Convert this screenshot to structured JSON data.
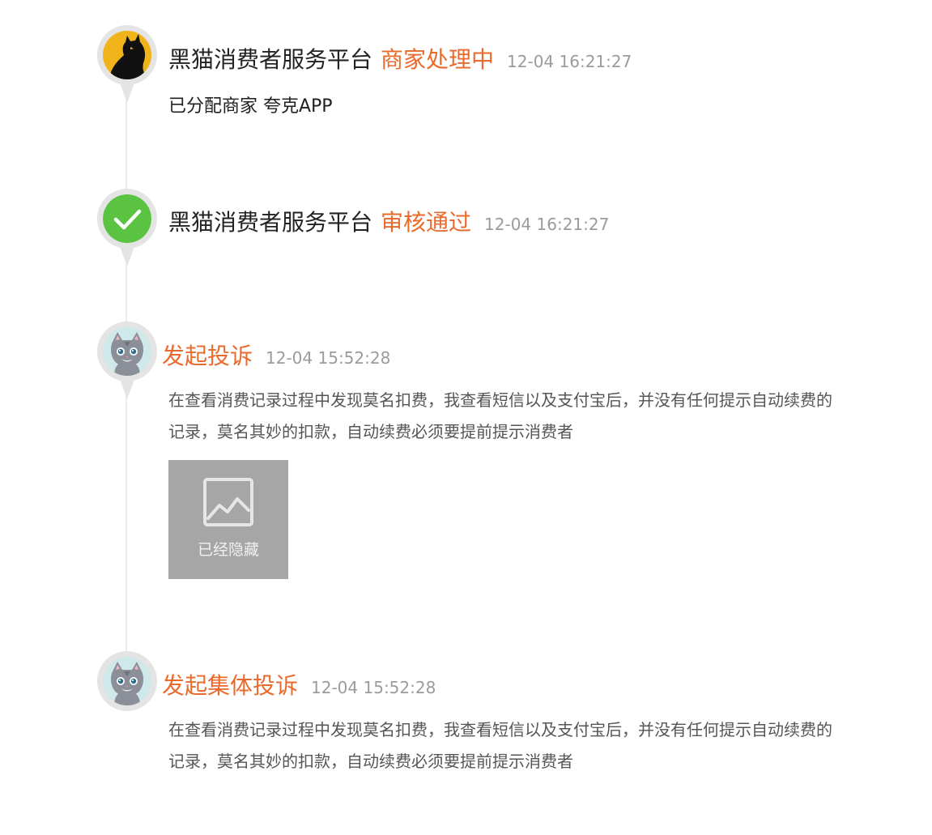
{
  "entries": [
    {
      "avatar": "black-cat-logo",
      "name": "黑猫消费者服务平台",
      "status": "商家处理中",
      "time": "12-04 16:21:27",
      "desc": "已分配商家 夸克APP"
    },
    {
      "avatar": "check-icon",
      "name": "黑猫消费者服务平台",
      "status": "审核通过",
      "time": "12-04 16:21:27"
    },
    {
      "avatar": "gray-cat-avatar",
      "status": "发起投诉",
      "time": "12-04 15:52:28",
      "text": "在查看消费记录过程中发现莫名扣费，我查看短信以及支付宝后，并没有任何提示自动续费的记录，莫名其妙的扣款，自动续费必须要提前提示消费者",
      "image_label": "已经隐藏"
    },
    {
      "avatar": "gray-cat-avatar",
      "status": "发起集体投诉",
      "time": "12-04 15:52:28",
      "text": "在查看消费记录过程中发现莫名扣费，我查看短信以及支付宝后，并没有任何提示自动续费的记录，莫名其妙的扣款，自动续费必须要提前提示消费者"
    }
  ],
  "colors": {
    "status": "#ea6a2c",
    "check_green": "#5ac341",
    "logo_yellow": "#f0b41a",
    "hidden_bg": "#a6a6a6",
    "time_gray": "#9b9b9b"
  }
}
